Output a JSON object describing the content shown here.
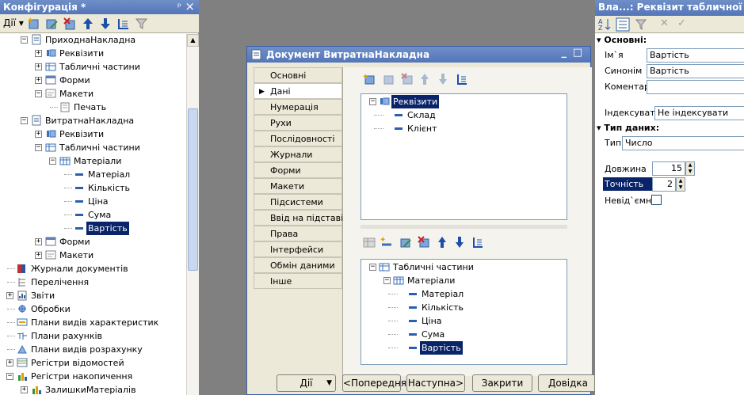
{
  "config_panel": {
    "title": "Конфігурація *",
    "pin": "ᵖ",
    "close": "×",
    "actions_label": "Дії",
    "tree": [
      {
        "label": "ПриходнаНакладна",
        "depth": 2,
        "icon": "document-icon",
        "exp": "−"
      },
      {
        "label": "Реквізити",
        "depth": 3,
        "icon": "attributes-icon",
        "exp": "+"
      },
      {
        "label": "Табличні частини",
        "depth": 3,
        "icon": "tabular-icon",
        "exp": "+"
      },
      {
        "label": "Форми",
        "depth": 3,
        "icon": "forms-icon",
        "exp": "+"
      },
      {
        "label": "Макети",
        "depth": 3,
        "icon": "templates-icon",
        "exp": "−"
      },
      {
        "label": "Печать",
        "depth": 4,
        "icon": "template-icon",
        "exp": ""
      },
      {
        "label": "ВитратнаНакладна",
        "depth": 2,
        "icon": "document-icon",
        "exp": "−"
      },
      {
        "label": "Реквізити",
        "depth": 3,
        "icon": "attributes-icon",
        "exp": "+"
      },
      {
        "label": "Табличні частини",
        "depth": 3,
        "icon": "tabular-icon",
        "exp": "−"
      },
      {
        "label": "Матеріали",
        "depth": 4,
        "icon": "table-icon",
        "exp": "−"
      },
      {
        "label": "Матеріал",
        "depth": 5,
        "icon": "field-icon",
        "exp": ""
      },
      {
        "label": "Кількість",
        "depth": 5,
        "icon": "field-icon",
        "exp": ""
      },
      {
        "label": "Ціна",
        "depth": 5,
        "icon": "field-icon",
        "exp": ""
      },
      {
        "label": "Сума",
        "depth": 5,
        "icon": "field-icon",
        "exp": ""
      },
      {
        "label": "Вартість",
        "depth": 5,
        "icon": "field-icon",
        "exp": "",
        "selected": true
      },
      {
        "label": "Форми",
        "depth": 3,
        "icon": "forms-icon",
        "exp": "+"
      },
      {
        "label": "Макети",
        "depth": 3,
        "icon": "templates-icon",
        "exp": "+"
      },
      {
        "label": "Журнали документів",
        "depth": 1,
        "icon": "journals-icon",
        "exp": ""
      },
      {
        "label": "Перелічення",
        "depth": 1,
        "icon": "enums-icon",
        "exp": ""
      },
      {
        "label": "Звіти",
        "depth": 1,
        "icon": "reports-icon",
        "exp": "+"
      },
      {
        "label": "Обробки",
        "depth": 1,
        "icon": "processing-icon",
        "exp": ""
      },
      {
        "label": "Плани видів характеристик",
        "depth": 1,
        "icon": "chart-types-icon",
        "exp": ""
      },
      {
        "label": "Плани рахунків",
        "depth": 1,
        "icon": "accounts-icon",
        "exp": ""
      },
      {
        "label": "Плани видів розрахунку",
        "depth": 1,
        "icon": "calc-types-icon",
        "exp": ""
      },
      {
        "label": "Регістри відомостей",
        "depth": 1,
        "icon": "info-registers-icon",
        "exp": "+"
      },
      {
        "label": "Регістри накопичення",
        "depth": 1,
        "icon": "accum-registers-icon",
        "exp": "−"
      },
      {
        "label": "ЗалишкиМатеріалів",
        "depth": 2,
        "icon": "register-icon",
        "exp": "+"
      }
    ]
  },
  "doc_window": {
    "title": "Документ ВитратнаНакладна",
    "minimize": "_",
    "maximize": "□",
    "tabs": [
      "Основні",
      "Дані",
      "Нумерація",
      "Рухи",
      "Послідовності",
      "Журнали",
      "Форми",
      "Макети",
      "Підсистеми",
      "Ввід на підставі",
      "Права",
      "Інтерфейси",
      "Обмін даними",
      "Інше"
    ],
    "active_tab": "Дані",
    "active_marker": "▶",
    "attributes_tree": [
      {
        "label": "Реквізити",
        "exp": "−",
        "depth": 0,
        "selected": true
      },
      {
        "label": "Склад",
        "depth": 1
      },
      {
        "label": "Клієнт",
        "depth": 1
      }
    ],
    "tabular_tree": [
      {
        "label": "Табличні частини",
        "exp": "−",
        "depth": 0
      },
      {
        "label": "Матеріали",
        "exp": "−",
        "depth": 1
      },
      {
        "label": "Матеріал",
        "depth": 2
      },
      {
        "label": "Кількість",
        "depth": 2
      },
      {
        "label": "Ціна",
        "depth": 2
      },
      {
        "label": "Сума",
        "depth": 2
      },
      {
        "label": "Вартість",
        "depth": 2,
        "selected": true
      }
    ],
    "buttons": {
      "actions": "Дії",
      "prev": "<Попередня",
      "next": "Наступна>",
      "close": "Закрити",
      "help": "Довідка"
    }
  },
  "props_panel": {
    "title": "Вла...: Реквізит табличної частини",
    "section_main": "Основні:",
    "name_label": "Ім`я",
    "name_value": "Вартість",
    "synonym_label": "Синонім",
    "synonym_value": "Вартість",
    "comment_label": "Коментар",
    "comment_value": "",
    "index_label": "Індексувати",
    "index_value": "Не індексувати",
    "section_type": "Тип даних:",
    "type_label": "Тип",
    "type_value": "Число",
    "length_label": "Довжина",
    "length_value": "15",
    "precision_label": "Точність",
    "precision_value": "2",
    "nonneg_label": "Невід`ємне",
    "section_marker": "▾",
    "action_x": "✕",
    "action_check": "✓"
  },
  "colors": {
    "accent": "#0a246a",
    "title": "#5a7dbe",
    "panel": "#ece9d8",
    "workspace": "#808080"
  }
}
